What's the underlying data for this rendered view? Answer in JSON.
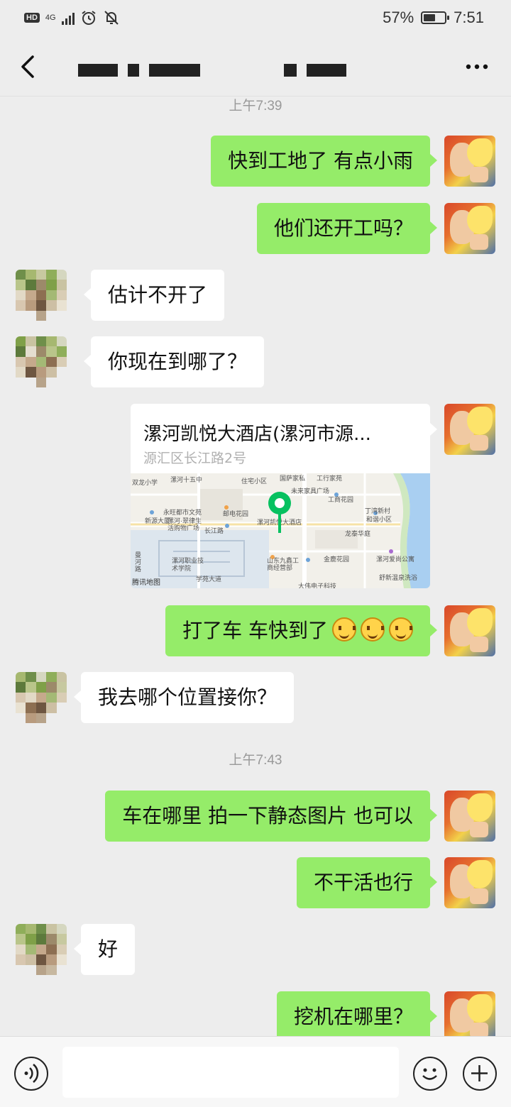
{
  "status_bar": {
    "network_badge": "HD",
    "network_type": "4G",
    "battery_percent": "57%",
    "battery_level": 0.57,
    "time": "7:51",
    "icons": [
      "hd-icon",
      "signal-icon",
      "alarm-icon",
      "mute-bell-icon",
      "battery-icon"
    ]
  },
  "nav": {
    "back_icon": "chevron-left-icon",
    "more_icon": "more-dots-icon",
    "title_obscured": true
  },
  "messages": {
    "time1": "上午7:39",
    "m1": "快到工地了 有点小雨",
    "m2": "他们还开工吗？",
    "m3": "估计不开了",
    "m4": "你现在到哪了？",
    "location": {
      "title": "漯河凯悦大酒店(漯河市源...",
      "address": "源汇区长江路2号",
      "map_provider": "腾讯地图",
      "map_labels": {
        "l1": "双龙小学",
        "l2": "漯河十五中",
        "l3": "住宅小区",
        "l4": "国萨家私",
        "l5": "工行家苑",
        "l6": "未来家具广场",
        "l7": "工商花园",
        "l8": "永旺都市文苑",
        "l9": "邮电花园",
        "l10": "丁湾新村",
        "l11": "和谐小区",
        "l12": "新源大厦",
        "l13": "漯河·翠律生活购物广场",
        "l14": "长江路",
        "l15": "漯河凯悦大酒店",
        "l16": "龙泰华庭",
        "l17": "漯河职业技术学院",
        "l18": "山东九鑫工商经营部",
        "l19": "金鹿花园",
        "l20": "漯河爱尚公寓",
        "l21": "舒新温泉洗浴",
        "l22": "学苑大道",
        "l23": "大伟电子科技",
        "l24": "曼河路"
      }
    },
    "m5": "打了车 车快到了",
    "m5_emoji": "smile-emoji",
    "m6": "我去哪个位置接你？",
    "time2": "上午7:43",
    "m7": "车在哪里 拍一下静态图片 也可以",
    "m8": "不干活也行",
    "m9": "好",
    "m10": "挖机在哪里？"
  },
  "input_bar": {
    "voice_icon": "voice-icon",
    "emoji_icon": "emoji-icon",
    "plus_icon": "plus-icon",
    "text_value": ""
  },
  "colors": {
    "background": "#ededed",
    "my_bubble": "#95ec69",
    "other_bubble": "#ffffff",
    "pin_green": "#07c160",
    "timestamp": "#999999"
  }
}
